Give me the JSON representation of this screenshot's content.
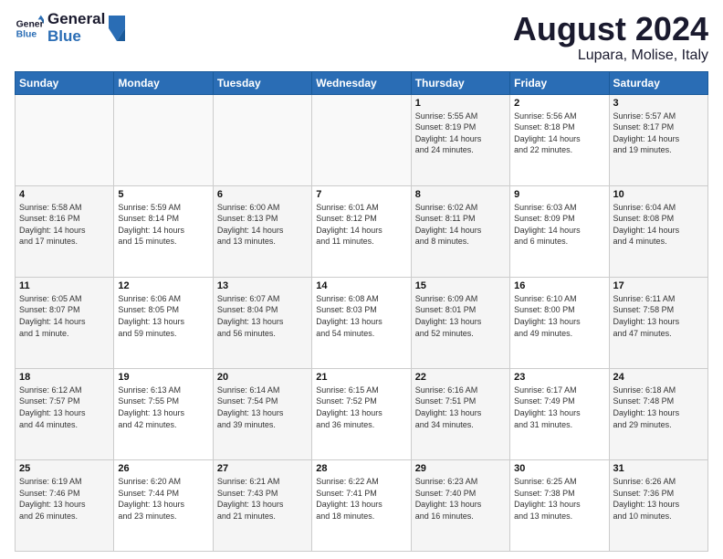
{
  "logo": {
    "line1": "General",
    "line2": "Blue"
  },
  "title": "August 2024",
  "subtitle": "Lupara, Molise, Italy",
  "days_header": [
    "Sunday",
    "Monday",
    "Tuesday",
    "Wednesday",
    "Thursday",
    "Friday",
    "Saturday"
  ],
  "weeks": [
    [
      {
        "day": "",
        "info": ""
      },
      {
        "day": "",
        "info": ""
      },
      {
        "day": "",
        "info": ""
      },
      {
        "day": "",
        "info": ""
      },
      {
        "day": "1",
        "info": "Sunrise: 5:55 AM\nSunset: 8:19 PM\nDaylight: 14 hours\nand 24 minutes."
      },
      {
        "day": "2",
        "info": "Sunrise: 5:56 AM\nSunset: 8:18 PM\nDaylight: 14 hours\nand 22 minutes."
      },
      {
        "day": "3",
        "info": "Sunrise: 5:57 AM\nSunset: 8:17 PM\nDaylight: 14 hours\nand 19 minutes."
      }
    ],
    [
      {
        "day": "4",
        "info": "Sunrise: 5:58 AM\nSunset: 8:16 PM\nDaylight: 14 hours\nand 17 minutes."
      },
      {
        "day": "5",
        "info": "Sunrise: 5:59 AM\nSunset: 8:14 PM\nDaylight: 14 hours\nand 15 minutes."
      },
      {
        "day": "6",
        "info": "Sunrise: 6:00 AM\nSunset: 8:13 PM\nDaylight: 14 hours\nand 13 minutes."
      },
      {
        "day": "7",
        "info": "Sunrise: 6:01 AM\nSunset: 8:12 PM\nDaylight: 14 hours\nand 11 minutes."
      },
      {
        "day": "8",
        "info": "Sunrise: 6:02 AM\nSunset: 8:11 PM\nDaylight: 14 hours\nand 8 minutes."
      },
      {
        "day": "9",
        "info": "Sunrise: 6:03 AM\nSunset: 8:09 PM\nDaylight: 14 hours\nand 6 minutes."
      },
      {
        "day": "10",
        "info": "Sunrise: 6:04 AM\nSunset: 8:08 PM\nDaylight: 14 hours\nand 4 minutes."
      }
    ],
    [
      {
        "day": "11",
        "info": "Sunrise: 6:05 AM\nSunset: 8:07 PM\nDaylight: 14 hours\nand 1 minute."
      },
      {
        "day": "12",
        "info": "Sunrise: 6:06 AM\nSunset: 8:05 PM\nDaylight: 13 hours\nand 59 minutes."
      },
      {
        "day": "13",
        "info": "Sunrise: 6:07 AM\nSunset: 8:04 PM\nDaylight: 13 hours\nand 56 minutes."
      },
      {
        "day": "14",
        "info": "Sunrise: 6:08 AM\nSunset: 8:03 PM\nDaylight: 13 hours\nand 54 minutes."
      },
      {
        "day": "15",
        "info": "Sunrise: 6:09 AM\nSunset: 8:01 PM\nDaylight: 13 hours\nand 52 minutes."
      },
      {
        "day": "16",
        "info": "Sunrise: 6:10 AM\nSunset: 8:00 PM\nDaylight: 13 hours\nand 49 minutes."
      },
      {
        "day": "17",
        "info": "Sunrise: 6:11 AM\nSunset: 7:58 PM\nDaylight: 13 hours\nand 47 minutes."
      }
    ],
    [
      {
        "day": "18",
        "info": "Sunrise: 6:12 AM\nSunset: 7:57 PM\nDaylight: 13 hours\nand 44 minutes."
      },
      {
        "day": "19",
        "info": "Sunrise: 6:13 AM\nSunset: 7:55 PM\nDaylight: 13 hours\nand 42 minutes."
      },
      {
        "day": "20",
        "info": "Sunrise: 6:14 AM\nSunset: 7:54 PM\nDaylight: 13 hours\nand 39 minutes."
      },
      {
        "day": "21",
        "info": "Sunrise: 6:15 AM\nSunset: 7:52 PM\nDaylight: 13 hours\nand 36 minutes."
      },
      {
        "day": "22",
        "info": "Sunrise: 6:16 AM\nSunset: 7:51 PM\nDaylight: 13 hours\nand 34 minutes."
      },
      {
        "day": "23",
        "info": "Sunrise: 6:17 AM\nSunset: 7:49 PM\nDaylight: 13 hours\nand 31 minutes."
      },
      {
        "day": "24",
        "info": "Sunrise: 6:18 AM\nSunset: 7:48 PM\nDaylight: 13 hours\nand 29 minutes."
      }
    ],
    [
      {
        "day": "25",
        "info": "Sunrise: 6:19 AM\nSunset: 7:46 PM\nDaylight: 13 hours\nand 26 minutes."
      },
      {
        "day": "26",
        "info": "Sunrise: 6:20 AM\nSunset: 7:44 PM\nDaylight: 13 hours\nand 23 minutes."
      },
      {
        "day": "27",
        "info": "Sunrise: 6:21 AM\nSunset: 7:43 PM\nDaylight: 13 hours\nand 21 minutes."
      },
      {
        "day": "28",
        "info": "Sunrise: 6:22 AM\nSunset: 7:41 PM\nDaylight: 13 hours\nand 18 minutes."
      },
      {
        "day": "29",
        "info": "Sunrise: 6:23 AM\nSunset: 7:40 PM\nDaylight: 13 hours\nand 16 minutes."
      },
      {
        "day": "30",
        "info": "Sunrise: 6:25 AM\nSunset: 7:38 PM\nDaylight: 13 hours\nand 13 minutes."
      },
      {
        "day": "31",
        "info": "Sunrise: 6:26 AM\nSunset: 7:36 PM\nDaylight: 13 hours\nand 10 minutes."
      }
    ]
  ]
}
